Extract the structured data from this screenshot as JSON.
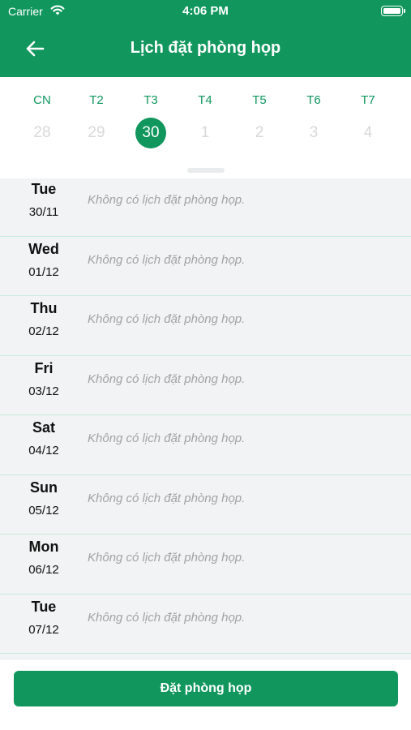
{
  "status_bar": {
    "carrier": "Carrier",
    "time": "4:06 PM"
  },
  "header": {
    "title": "Lịch đặt phòng họp"
  },
  "week": {
    "days": [
      {
        "name": "CN",
        "num": "28",
        "selected": false
      },
      {
        "name": "T2",
        "num": "29",
        "selected": false
      },
      {
        "name": "T3",
        "num": "30",
        "selected": true
      },
      {
        "name": "T4",
        "num": "1",
        "selected": false
      },
      {
        "name": "T5",
        "num": "2",
        "selected": false
      },
      {
        "name": "T6",
        "num": "3",
        "selected": false
      },
      {
        "name": "T7",
        "num": "4",
        "selected": false
      }
    ]
  },
  "agenda": {
    "empty_text": "Không có lịch đặt phòng họp.",
    "rows": [
      {
        "day": "Tue",
        "date": "30/11",
        "empty": "Không có lịch đặt phòng họp."
      },
      {
        "day": "Wed",
        "date": "01/12",
        "empty": "Không có lịch đặt phòng họp."
      },
      {
        "day": "Thu",
        "date": "02/12",
        "empty": "Không có lịch đặt phòng họp."
      },
      {
        "day": "Fri",
        "date": "03/12",
        "empty": "Không có lịch đặt phòng họp."
      },
      {
        "day": "Sat",
        "date": "04/12",
        "empty": "Không có lịch đặt phòng họp."
      },
      {
        "day": "Sun",
        "date": "05/12",
        "empty": "Không có lịch đặt phòng họp."
      },
      {
        "day": "Mon",
        "date": "06/12",
        "empty": "Không có lịch đặt phòng họp."
      },
      {
        "day": "Tue",
        "date": "07/12",
        "empty": "Không có lịch đặt phòng họp."
      }
    ]
  },
  "footer": {
    "book_label": "Đặt phòng họp"
  },
  "colors": {
    "brand": "#11975e",
    "list_bg": "#f1f3f4",
    "divider": "#c8ebdc",
    "muted": "#a3a3a3"
  }
}
